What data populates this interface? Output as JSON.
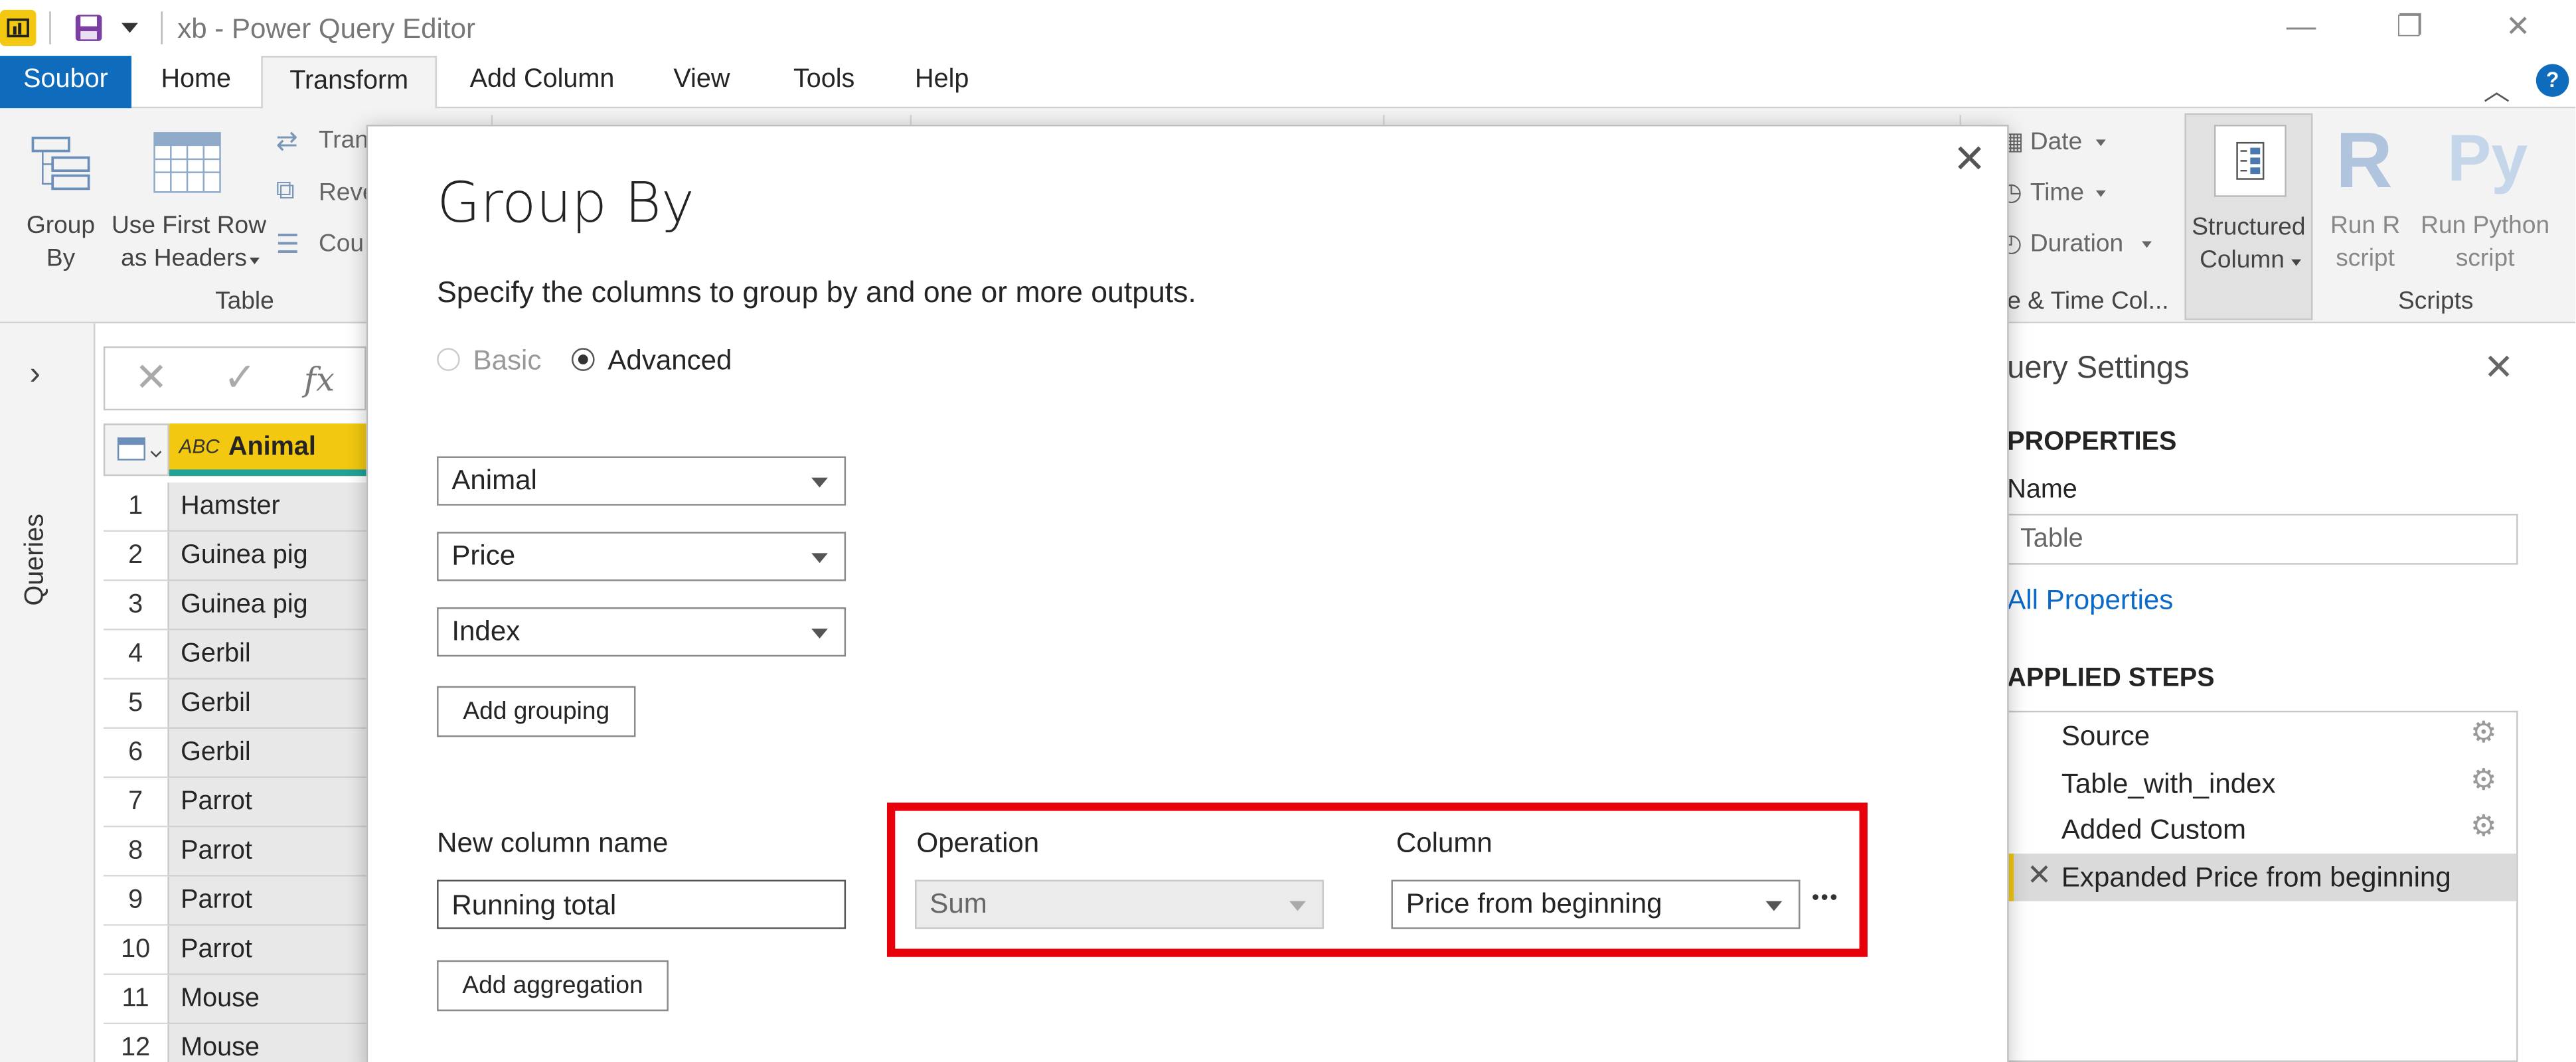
{
  "window": {
    "title": "xb - Power Query Editor"
  },
  "menu_tabs": [
    "Soubor",
    "Home",
    "Transform",
    "Add Column",
    "View",
    "Tools",
    "Help"
  ],
  "ribbon": {
    "group_by": "Group\nBy",
    "group_by_l1": "Group",
    "group_by_l2": "By",
    "use_first_row_l1": "Use First Row",
    "use_first_row_l2": "as Headers",
    "transpose": "Tran",
    "reverse_rows": "Reve",
    "count_rows": "Cou",
    "table_group": "Table",
    "date": "Date",
    "time": "Time",
    "duration": "Duration",
    "datetime_group": "e & Time Col...",
    "structured_l1": "Structured",
    "structured_l2": "Column",
    "run_r_l1": "Run R",
    "run_r_l2": "script",
    "run_py_l1": "Run Python",
    "run_py_l2": "script",
    "scripts_group": "Scripts"
  },
  "queries_pane": {
    "label": "Queries"
  },
  "formula_bar": {
    "fx": "fx"
  },
  "grid": {
    "column_header": "Animal",
    "type_glyph": "ABC",
    "rows": [
      {
        "n": "1",
        "v": "Hamster"
      },
      {
        "n": "2",
        "v": "Guinea pig"
      },
      {
        "n": "3",
        "v": "Guinea pig"
      },
      {
        "n": "4",
        "v": "Gerbil"
      },
      {
        "n": "5",
        "v": "Gerbil"
      },
      {
        "n": "6",
        "v": "Gerbil"
      },
      {
        "n": "7",
        "v": "Parrot"
      },
      {
        "n": "8",
        "v": "Parrot"
      },
      {
        "n": "9",
        "v": "Parrot"
      },
      {
        "n": "10",
        "v": "Parrot"
      },
      {
        "n": "11",
        "v": "Mouse"
      },
      {
        "n": "12",
        "v": "Mouse"
      }
    ]
  },
  "query_settings": {
    "title": "uery Settings",
    "properties_heading": "PROPERTIES",
    "name_label": "Name",
    "name_value": "Table",
    "all_properties": "All Properties",
    "applied_steps_heading": "APPLIED STEPS",
    "steps": [
      {
        "label": "Source",
        "gear": true
      },
      {
        "label": "Table_with_index",
        "gear": true
      },
      {
        "label": "Added Custom",
        "gear": true
      },
      {
        "label": "Expanded Price from beginning",
        "gear": false
      }
    ]
  },
  "dialog": {
    "title": "Group By",
    "subtitle": "Specify the columns to group by and one or more outputs.",
    "mode_basic": "Basic",
    "mode_advanced": "Advanced",
    "grouping_columns": [
      "Animal",
      "Price",
      "Index"
    ],
    "add_grouping": "Add grouping",
    "new_column_name_label": "New column name",
    "new_column_name_value": "Running total",
    "operation_label": "Operation",
    "operation_value": "Sum",
    "column_label": "Column",
    "column_value": "Price from beginning",
    "more_glyph": "•••",
    "add_aggregation": "Add aggregation"
  },
  "colors": {
    "accent_blue": "#0f6cbd",
    "highlight_red": "#e8000b",
    "column_yellow": "#f2c811",
    "link_blue": "#0b6ac9"
  }
}
